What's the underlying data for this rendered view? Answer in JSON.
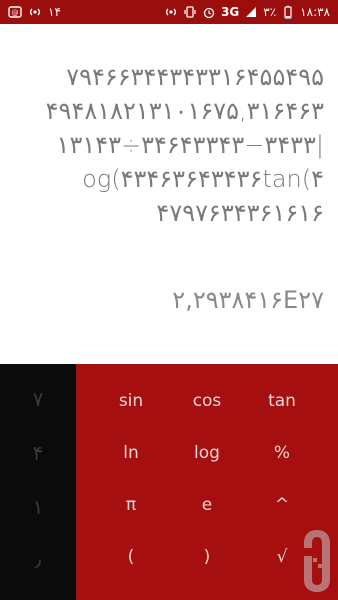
{
  "status_bar": {
    "left_text": "۱۴",
    "time": "۱۸:۳۸",
    "battery": "۳٪",
    "network": "3G",
    "network_sup": "3G"
  },
  "display": {
    "expression_lines": [
      "۷۹۴۶۶۳۴۴۳۴۳۳۱۶۴۵۵۴۹۵",
      "۴۹۴۸۱۸۲۱۳۱۰۱۶۷۵,۳۱۶۴۶۳",
      "۱۳۱۴۳÷۳۴۶۴۳۳۴۳−۳۴۳۳|",
      "og(۴۳۴۶۳۶۴۳۴۳۶tan(۴",
      "۴۷۹۷۶۳۴۳۶۱۶۱۶"
    ],
    "result": "۲,۲۹۳۸۴۱۶E۲۷"
  },
  "keypad": {
    "digits": [
      "۷",
      "۴",
      "۱",
      "٫"
    ],
    "scientific": [
      [
        "sin",
        "cos",
        "tan"
      ],
      [
        "ln",
        "log",
        "%"
      ],
      [
        "π",
        "e",
        "^"
      ],
      [
        "(",
        ")",
        "√"
      ]
    ]
  },
  "colors": {
    "accent": "#a50f0f",
    "status_bar": "#9b0e0e",
    "digit_pad": "#0b0b0b",
    "display_text": "#7a7a7a"
  },
  "icons": {
    "status_left": [
      "wifi-calling-icon",
      "hotspot-icon"
    ],
    "status_right": [
      "hotspot-icon",
      "vibrate-icon",
      "alarm-icon",
      "signal-icon",
      "battery-icon"
    ],
    "watermark": "app-store-logo-icon"
  }
}
